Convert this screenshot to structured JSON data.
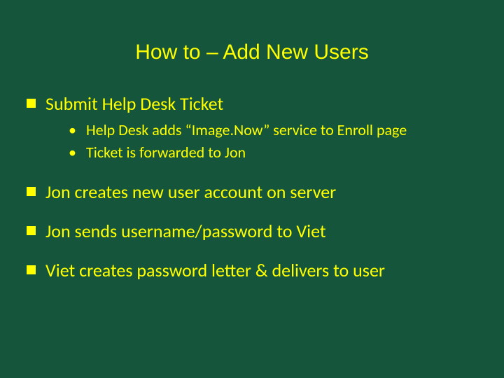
{
  "title": "How to – Add New Users",
  "bullets": [
    {
      "text": "Submit Help Desk Ticket",
      "sub": [
        "Help Desk adds “Image.Now” service to Enroll page",
        "Ticket is forwarded to Jon"
      ]
    },
    {
      "text": "Jon creates new user account on server",
      "sub": []
    },
    {
      "text": "Jon sends username/password to Viet",
      "sub": []
    },
    {
      "text": "Viet creates password letter & delivers to user",
      "sub": []
    }
  ]
}
